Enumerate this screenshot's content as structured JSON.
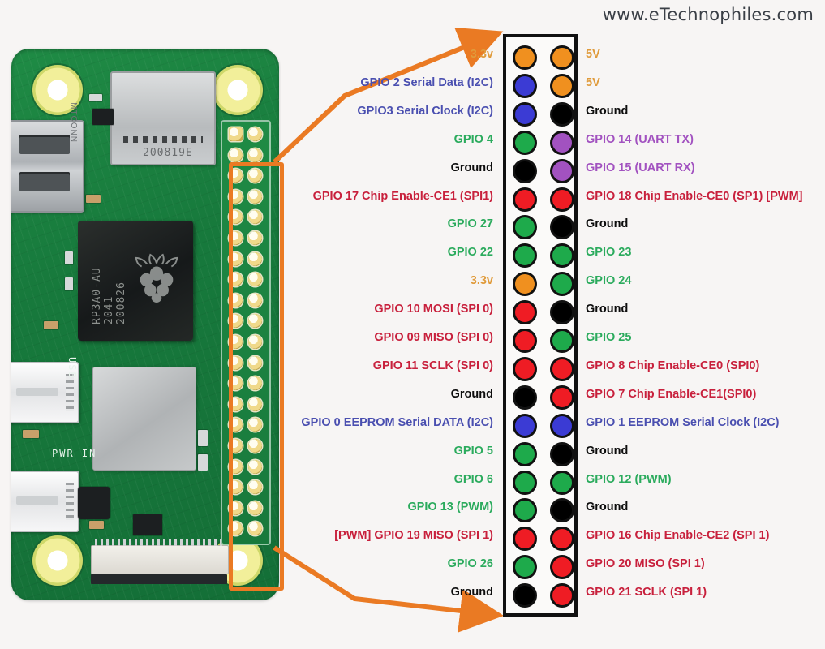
{
  "watermark": "www.eTechnophiles.com",
  "board": {
    "soc_text": "RP3A0-AU\n2041\n200826",
    "sd_slot_text": "200819E",
    "hdmi_text": "MTCONN",
    "silk_usb": "USB",
    "silk_pwr": "PWR IN",
    "highlight_color": "#ea7a23"
  },
  "colors": {
    "power33": "#f0901f",
    "power5v": "#f0901f",
    "ground": "#000000",
    "gpio_green": "#1eaa4b",
    "i2c_blue": "#3b3bd4",
    "uart_purple": "#a252c0",
    "spi_red": "#ef1c24",
    "text_orange": "#e09b3b",
    "text_green": "#2bab5d",
    "text_blue": "#4a4fb0",
    "text_purple": "#a252c0",
    "text_red": "#c8203c",
    "text_black": "#0d0d0d"
  },
  "pins": [
    {
      "n": 1,
      "left_label": "3.3v",
      "left_color": "#e09b3b",
      "left_dot": "#f0901f",
      "right_label": "5V",
      "right_color": "#e09b3b",
      "right_dot": "#f0901f"
    },
    {
      "n": 3,
      "left_label": "GPIO 2 Serial Data (I2C)",
      "left_color": "#4a4fb0",
      "left_dot": "#3b3bd4",
      "right_label": "5V",
      "right_color": "#e09b3b",
      "right_dot": "#f0901f"
    },
    {
      "n": 5,
      "left_label": "GPIO3 Serial Clock (I2C)",
      "left_color": "#4a4fb0",
      "left_dot": "#3b3bd4",
      "right_label": "Ground",
      "right_color": "#0d0d0d",
      "right_dot": "#000000"
    },
    {
      "n": 7,
      "left_label": "GPIO 4",
      "left_color": "#2bab5d",
      "left_dot": "#1eaa4b",
      "right_label": "GPIO 14 (UART TX)",
      "right_color": "#a252c0",
      "right_dot": "#a252c0"
    },
    {
      "n": 9,
      "left_label": "Ground",
      "left_color": "#0d0d0d",
      "left_dot": "#000000",
      "right_label": "GPIO 15 (UART RX)",
      "right_color": "#a252c0",
      "right_dot": "#a252c0"
    },
    {
      "n": 11,
      "left_label": "GPIO 17 Chip Enable-CE1 (SPI1)",
      "left_color": "#c8203c",
      "left_dot": "#ef1c24",
      "right_label": "GPIO 18 Chip Enable-CE0 (SP1) [PWM]",
      "right_color": "#c8203c",
      "right_dot": "#ef1c24"
    },
    {
      "n": 13,
      "left_label": "GPIO 27",
      "left_color": "#2bab5d",
      "left_dot": "#1eaa4b",
      "right_label": "Ground",
      "right_color": "#0d0d0d",
      "right_dot": "#000000"
    },
    {
      "n": 15,
      "left_label": "GPIO 22",
      "left_color": "#2bab5d",
      "left_dot": "#1eaa4b",
      "right_label": "GPIO 23",
      "right_color": "#2bab5d",
      "right_dot": "#1eaa4b"
    },
    {
      "n": 17,
      "left_label": "3.3v",
      "left_color": "#e09b3b",
      "left_dot": "#f0901f",
      "right_label": "GPIO 24",
      "right_color": "#2bab5d",
      "right_dot": "#1eaa4b"
    },
    {
      "n": 19,
      "left_label": "GPIO 10 MOSI (SPI 0)",
      "left_color": "#c8203c",
      "left_dot": "#ef1c24",
      "right_label": "Ground",
      "right_color": "#0d0d0d",
      "right_dot": "#000000"
    },
    {
      "n": 21,
      "left_label": "GPIO 09 MISO (SPI 0)",
      "left_color": "#c8203c",
      "left_dot": "#ef1c24",
      "right_label": "GPIO 25",
      "right_color": "#2bab5d",
      "right_dot": "#1eaa4b"
    },
    {
      "n": 23,
      "left_label": "GPIO 11 SCLK (SPI 0)",
      "left_color": "#c8203c",
      "left_dot": "#ef1c24",
      "right_label": "GPIO 8 Chip Enable-CE0 (SPI0)",
      "right_color": "#c8203c",
      "right_dot": "#ef1c24"
    },
    {
      "n": 25,
      "left_label": "Ground",
      "left_color": "#0d0d0d",
      "left_dot": "#000000",
      "right_label": "GPIO 7 Chip Enable-CE1(SPI0)",
      "right_color": "#c8203c",
      "right_dot": "#ef1c24"
    },
    {
      "n": 27,
      "left_label": "GPIO 0 EEPROM Serial DATA (I2C)",
      "left_color": "#4a4fb0",
      "left_dot": "#3b3bd4",
      "right_label": "GPIO 1 EEPROM Serial Clock (I2C)",
      "right_color": "#4a4fb0",
      "right_dot": "#3b3bd4"
    },
    {
      "n": 29,
      "left_label": "GPIO 5",
      "left_color": "#2bab5d",
      "left_dot": "#1eaa4b",
      "right_label": "Ground",
      "right_color": "#0d0d0d",
      "right_dot": "#000000"
    },
    {
      "n": 31,
      "left_label": "GPIO 6",
      "left_color": "#2bab5d",
      "left_dot": "#1eaa4b",
      "right_label": "GPIO 12 (PWM)",
      "right_color": "#2bab5d",
      "right_dot": "#1eaa4b"
    },
    {
      "n": 33,
      "left_label": "GPIO 13 (PWM)",
      "left_color": "#2bab5d",
      "left_dot": "#1eaa4b",
      "right_label": "Ground",
      "right_color": "#0d0d0d",
      "right_dot": "#000000"
    },
    {
      "n": 35,
      "left_label": "[PWM] GPIO 19 MISO (SPI 1)",
      "left_color": "#c8203c",
      "left_dot": "#ef1c24",
      "right_label": "GPIO 16 Chip Enable-CE2 (SPI 1)",
      "right_color": "#c8203c",
      "right_dot": "#ef1c24"
    },
    {
      "n": 37,
      "left_label": "GPIO 26",
      "left_color": "#2bab5d",
      "left_dot": "#1eaa4b",
      "right_label": "GPIO 20 MISO (SPI 1)",
      "right_color": "#c8203c",
      "right_dot": "#ef1c24"
    },
    {
      "n": 39,
      "left_label": "Ground",
      "left_color": "#0d0d0d",
      "left_dot": "#000000",
      "right_label": "GPIO 21 SCLK (SPI 1)",
      "right_color": "#c8203c",
      "right_dot": "#ef1c24"
    }
  ]
}
